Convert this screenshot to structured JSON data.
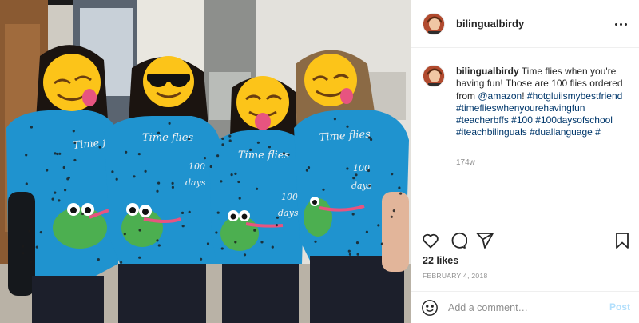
{
  "post": {
    "username": "bilingualbirdy",
    "caption_text": "Time flies when you're having fun! Those are 100 flies ordered from",
    "mention": "@amazon",
    "caption_after_mention": "!",
    "hashtags": [
      "#hotgluiismybestfriend",
      "#timeflieswhenyourehavingfun",
      "#teacherbffs",
      "#100",
      "#100daysofschool",
      "#iteachbilinguals",
      "#duallanguage",
      "#"
    ],
    "relative_time": "174w",
    "likes": "22 likes",
    "date": "FEBRUARY 4, 2018"
  },
  "comment": {
    "placeholder": "Add a comment…",
    "post_label": "Post"
  },
  "photo": {
    "shirt_text_1": "Time flies",
    "shirt_text_2": "100",
    "shirt_text_3": "days"
  },
  "icons": {
    "more": "more-options-icon",
    "like": "heart-icon",
    "comment": "comment-bubble-icon",
    "share": "paper-plane-icon",
    "save": "bookmark-icon",
    "emoji": "smiley-icon"
  },
  "colors": {
    "shirt": "#1f93cf",
    "emoji": "#fcc419",
    "link": "#00376b",
    "post_button": "#b2dffc",
    "muted": "#8e8e8e"
  }
}
